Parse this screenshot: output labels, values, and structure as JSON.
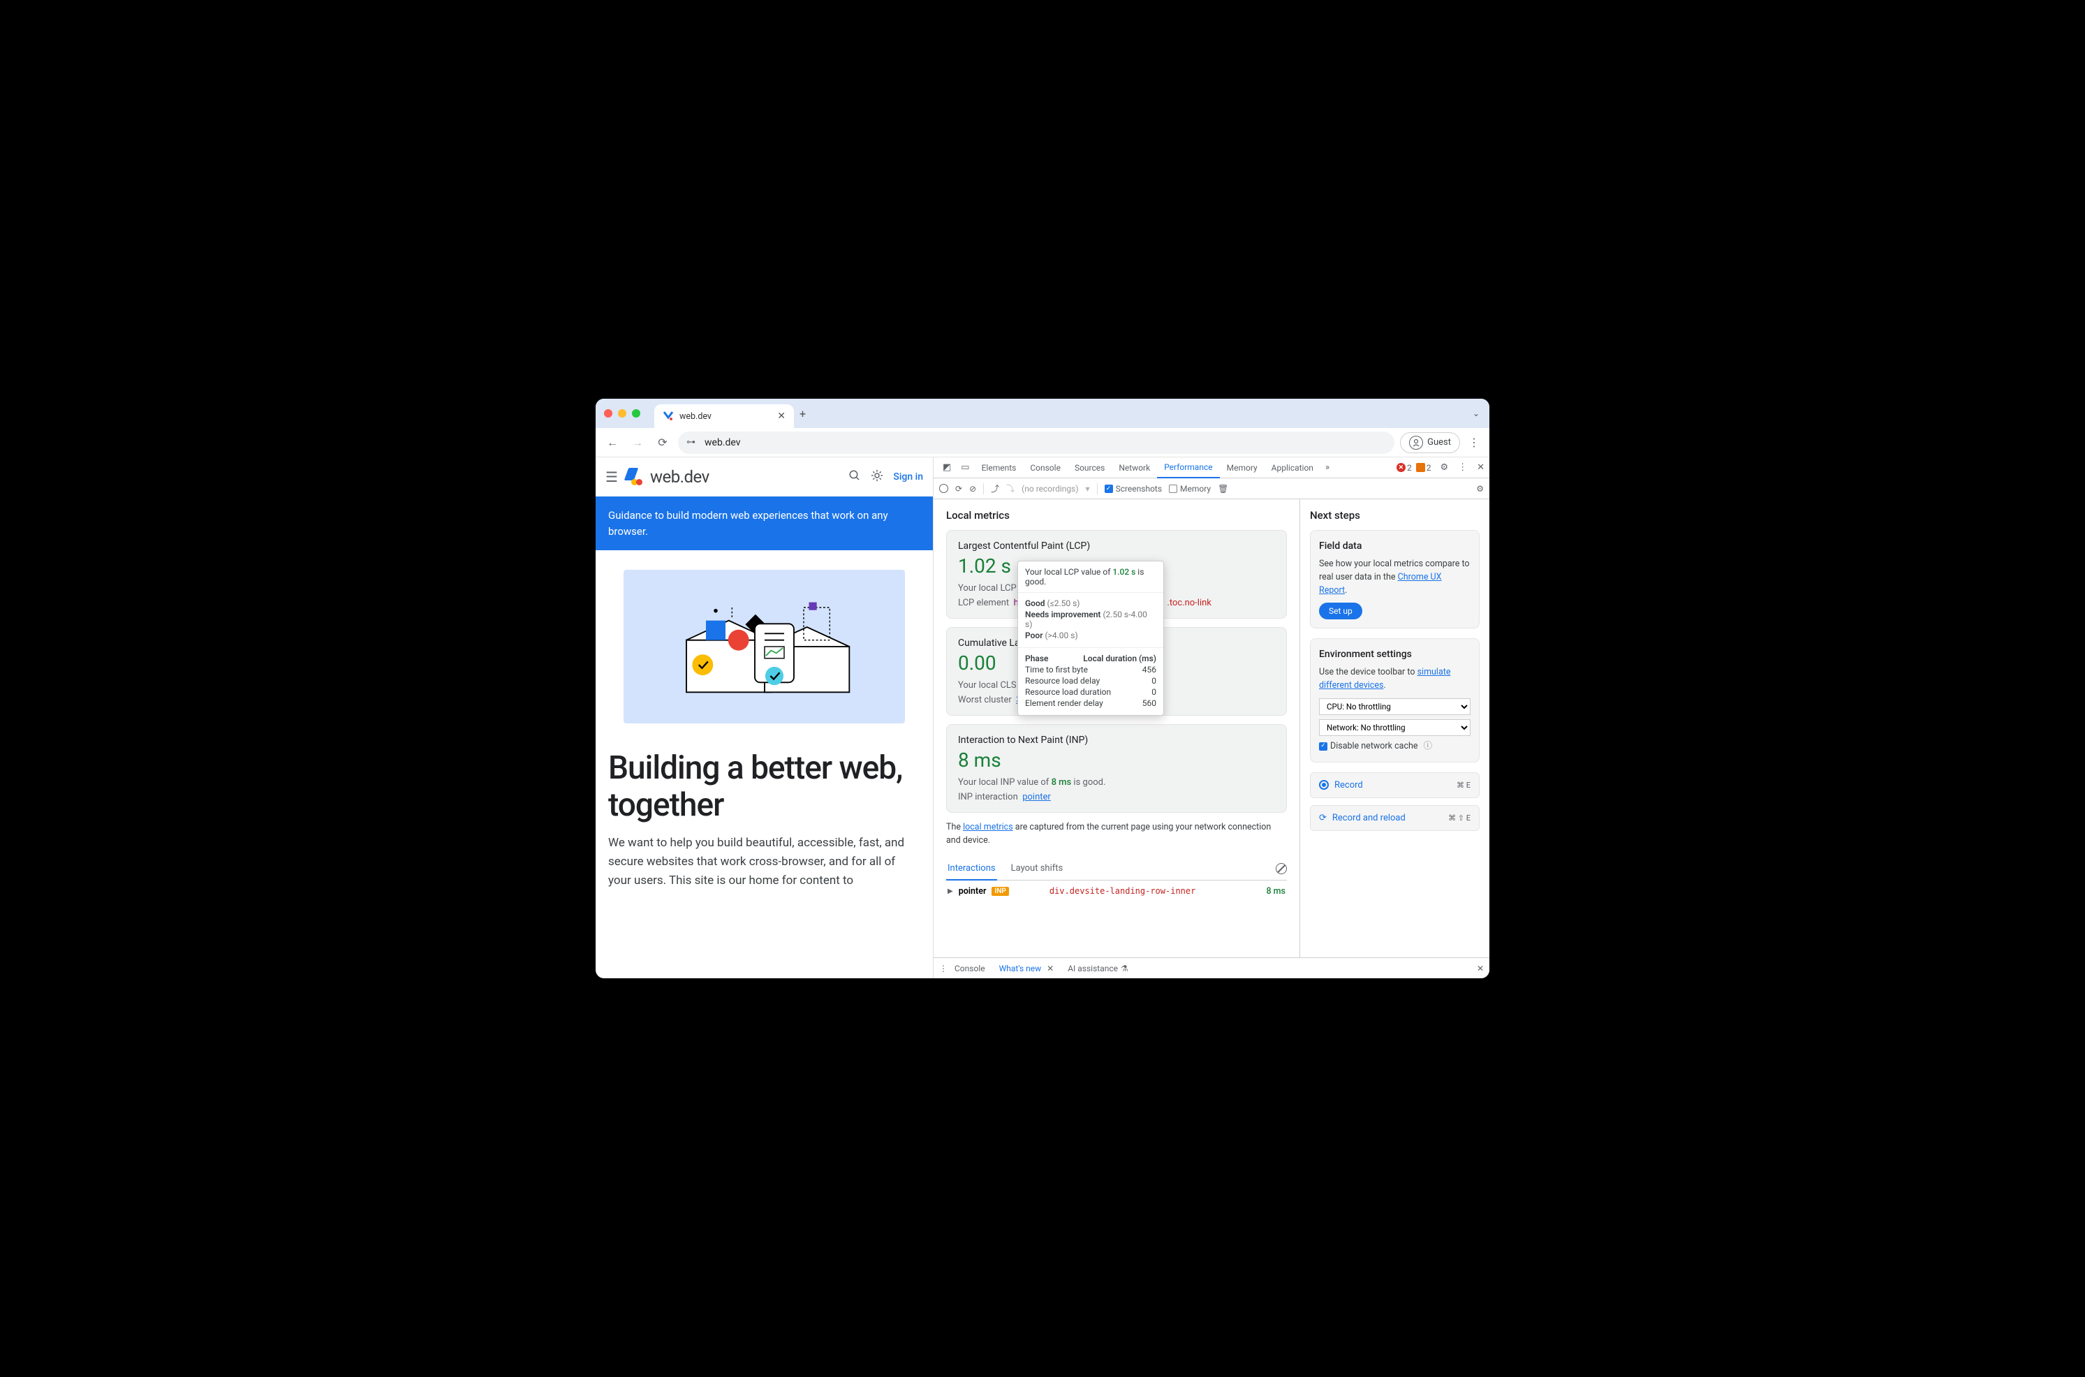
{
  "browser": {
    "tab_title": "web.dev",
    "url": "web.dev",
    "guest_label": "Guest"
  },
  "site": {
    "brand": "web.dev",
    "signin": "Sign in",
    "banner": "Guidance to build modern web experiences that work on any browser.",
    "h1": "Building a better web, together",
    "lead": "We want to help you build beautiful, accessible, fast, and secure websites that work cross-browser, and for all of your users. This site is our home for content to"
  },
  "devtools": {
    "tabs": [
      "Elements",
      "Console",
      "Sources",
      "Network",
      "Performance",
      "Memory",
      "Application"
    ],
    "errors": "2",
    "warnings": "2",
    "toolbar": {
      "no_rec": "(no recordings)",
      "screenshots": "Screenshots",
      "memory": "Memory"
    },
    "local_metrics_title": "Local metrics",
    "lcp": {
      "name": "Largest Contentful Paint (LCP)",
      "value": "1.02 s",
      "note_pre": "Your local LCP valu",
      "el_label": "LCP element",
      "el_tag": "h3#b",
      "el_cls": ".toc.no-link"
    },
    "cls": {
      "name": "Cumulative Lay",
      "value": "0.00",
      "note_pre": "Your local CLS valu",
      "worst_label": "Worst cluster",
      "worst_link": "3 shifts"
    },
    "inp": {
      "name": "Interaction to Next Paint (INP)",
      "value": "8 ms",
      "note_pre": "Your local INP value of ",
      "note_val": "8 ms",
      "note_post": " is good.",
      "el_label": "INP interaction",
      "el_link": "pointer"
    },
    "tooltip": {
      "head_pre": "Your local LCP value of ",
      "head_val": "1.02 s",
      "head_post": " is good.",
      "good_lbl": "Good",
      "good_rng": "(≤2.50 s)",
      "ni_lbl": "Needs improvement",
      "ni_rng": "(2.50 s-4.00 s)",
      "poor_lbl": "Poor",
      "poor_rng": "(>4.00 s)",
      "phase_hdr": "Phase",
      "dur_hdr": "Local duration (ms)",
      "rows": [
        {
          "name": "Time to first byte",
          "val": "456"
        },
        {
          "name": "Resource load delay",
          "val": "0"
        },
        {
          "name": "Resource load duration",
          "val": "0"
        },
        {
          "name": "Element render delay",
          "val": "560"
        }
      ]
    },
    "caption_pre": "The ",
    "caption_link": "local metrics",
    "caption_post": " are captured from the current page using your network connection and device.",
    "subtabs": {
      "interactions": "Interactions",
      "shifts": "Layout shifts"
    },
    "int_row": {
      "kind": "pointer",
      "badge": "INP",
      "elem": "div.devsite-landing-row-inner",
      "time": "8 ms"
    },
    "side": {
      "next_steps": "Next steps",
      "field_title": "Field data",
      "field_body_pre": "See how your local metrics compare to real user data in the ",
      "field_link": "Chrome UX Report",
      "setup": "Set up",
      "env_title": "Environment settings",
      "env_body_pre": "Use the device toolbar to ",
      "env_link": "simulate different devices",
      "cpu": "CPU: No throttling",
      "net": "Network: No throttling",
      "disable_cache": "Disable network cache",
      "record": "Record",
      "record_sc": "⌘ E",
      "record_reload": "Record and reload",
      "record_reload_sc": "⌘ ⇧ E"
    },
    "drawer": {
      "console": "Console",
      "whatsnew": "What's new",
      "ai": "AI assistance"
    }
  }
}
